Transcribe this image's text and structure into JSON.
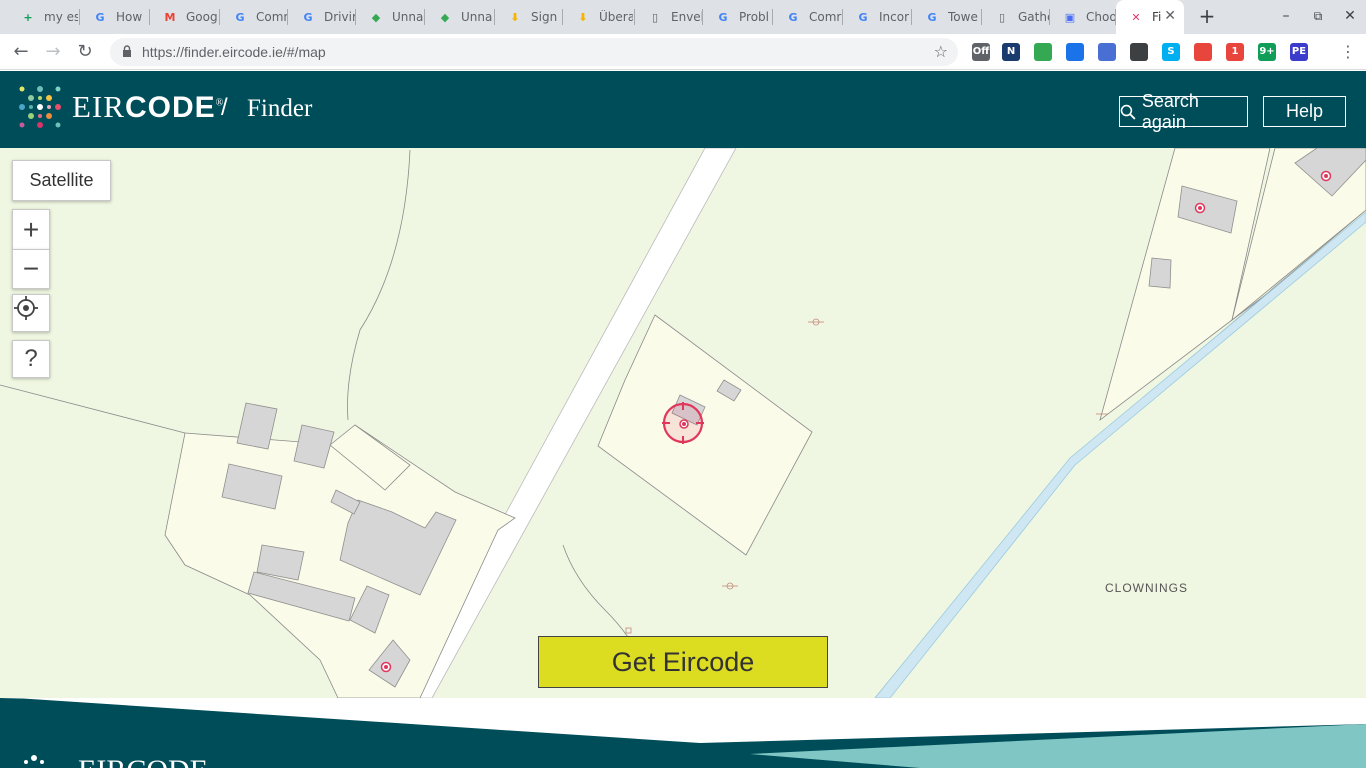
{
  "browser": {
    "tabs": [
      {
        "label": "my es",
        "icon": "sheets-icon",
        "color": "#0f9d58"
      },
      {
        "label": "How",
        "icon": "google-icon",
        "color": "#4285f4"
      },
      {
        "label": "Goog",
        "icon": "gmail-icon",
        "color": "#ea4335"
      },
      {
        "label": "Comr",
        "icon": "google-icon",
        "color": "#4285f4"
      },
      {
        "label": "Drivir",
        "icon": "google-icon",
        "color": "#4285f4"
      },
      {
        "label": "Unna",
        "icon": "maps-icon",
        "color": "#34a853"
      },
      {
        "label": "Unna",
        "icon": "maps-icon",
        "color": "#34a853"
      },
      {
        "label": "Sign",
        "icon": "download-icon",
        "color": "#f4b400"
      },
      {
        "label": "Übera",
        "icon": "download-icon",
        "color": "#f4b400"
      },
      {
        "label": "Envel",
        "icon": "document-icon",
        "color": "#5f6368"
      },
      {
        "label": "Probl",
        "icon": "google-icon",
        "color": "#4285f4"
      },
      {
        "label": "Comr",
        "icon": "google-icon",
        "color": "#4285f4"
      },
      {
        "label": "Incor",
        "icon": "google-icon",
        "color": "#4285f4"
      },
      {
        "label": "Towe",
        "icon": "google-icon",
        "color": "#4285f4"
      },
      {
        "label": "Gathe",
        "icon": "document-icon",
        "color": "#5f6368"
      },
      {
        "label": "Choo",
        "icon": "account-icon",
        "color": "#4c6ef5"
      },
      {
        "label": "Fi",
        "icon": "eircode-icon",
        "color": "#e03c6b",
        "active": true
      }
    ],
    "url_host": "https://finder.eircode.ie",
    "url_path": "/#/map",
    "extensions": [
      {
        "name": "incognito-ext-icon",
        "badge": "Off",
        "color": "#5f6368"
      },
      {
        "name": "n-ext-icon",
        "badge": "N",
        "color": "#1a3b6e"
      },
      {
        "name": "clipboard-ext-icon",
        "badge": "",
        "color": "#34a853"
      },
      {
        "name": "link-ext-icon",
        "badge": "",
        "color": "#1a73e8"
      },
      {
        "name": "camera-ext-icon",
        "badge": "",
        "color": "#4a6fd4"
      },
      {
        "name": "scissors-ext-icon",
        "badge": "",
        "color": "#3c4043"
      },
      {
        "name": "skype-ext-icon",
        "badge": "S",
        "color": "#00aff0"
      },
      {
        "name": "notify-ext-icon",
        "badge": "",
        "color": "#e8453c"
      },
      {
        "name": "mail-ext-icon",
        "badge": "1",
        "color": "#e8453c"
      },
      {
        "name": "chat-ext-icon",
        "badge": "9+",
        "color": "#0f9d58"
      },
      {
        "name": "pe-ext-icon",
        "badge": "PE",
        "color": "#3c3ccc"
      }
    ]
  },
  "header": {
    "brand_light": "EIR",
    "brand_bold": "CODE",
    "brand_mark": "®",
    "section": "Finder",
    "search_again": "Search again",
    "help": "Help",
    "bg_color": "#004d5a"
  },
  "map": {
    "satellite_label": "Satellite",
    "zoom_in": "+",
    "zoom_out": "−",
    "help_label": "?",
    "townland": "CLOWNINGS",
    "get_eircode": "Get Eircode",
    "marker_color": "#e0385c",
    "button_color": "#dcdc21"
  }
}
